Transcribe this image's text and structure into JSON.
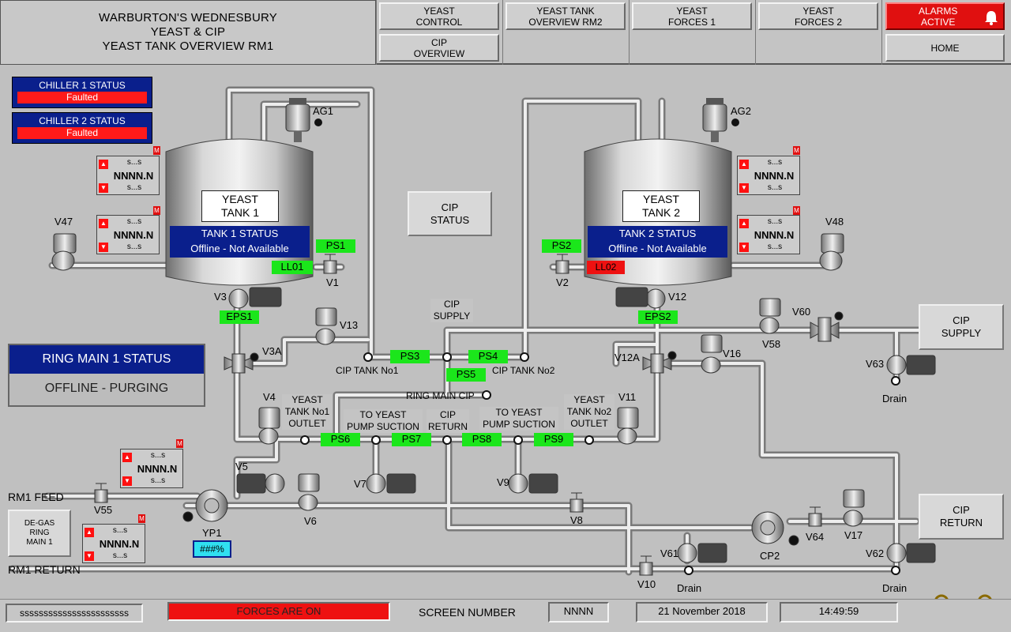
{
  "header": {
    "title_lines": [
      "WARBURTON'S WEDNESBURY",
      "YEAST & CIP",
      "YEAST TANK OVERVIEW RM1"
    ],
    "nav": {
      "yeast_control": "YEAST\nCONTROL",
      "yeast_tank_overview_rm2": "YEAST TANK\nOVERVIEW RM2",
      "yeast_forces_1": "YEAST\nFORCES 1",
      "yeast_forces_2": "YEAST\nFORCES 2",
      "alarms": "ALARMS\nACTIVE",
      "cip_overview": "CIP\nOVERVIEW",
      "home": "HOME"
    }
  },
  "chillers": [
    {
      "label": "CHILLER 1 STATUS",
      "state": "Faulted"
    },
    {
      "label": "CHILLER 2 STATUS",
      "state": "Faulted"
    }
  ],
  "ring_main": {
    "title": "RING MAIN 1 STATUS",
    "state": "OFFLINE - PURGING"
  },
  "tanks": [
    {
      "name_lines": [
        "YEAST",
        "TANK 1"
      ],
      "status_title": "TANK 1 STATUS",
      "status": "Offline - Not Available",
      "agitator": "AG1",
      "level_tag": "LL01",
      "level_color": "#1be61b"
    },
    {
      "name_lines": [
        "YEAST",
        "TANK 2"
      ],
      "status_title": "TANK 2 STATUS",
      "status": "Offline - Not Available",
      "agitator": "AG2",
      "level_tag": "LL02",
      "level_color": "#ee1111"
    }
  ],
  "cip_status": "CIP\nSTATUS",
  "cip_supply_btn": "CIP\nSUPPLY",
  "cip_return_btn": "CIP\nRETURN",
  "degas_btn": "DE-GAS\nRING\nMAIN 1",
  "indicator": {
    "top": "s...s",
    "value": "NNNN.N",
    "bottom": "s...s",
    "badge": "M"
  },
  "pressure_switches": [
    "PS1",
    "PS2",
    "PS3",
    "PS4",
    "PS5",
    "PS6",
    "PS7",
    "PS8",
    "PS9"
  ],
  "eps": [
    "EPS1",
    "EPS2"
  ],
  "valves": [
    "V1",
    "V2",
    "V3",
    "V3A",
    "V4",
    "V5",
    "V6",
    "V7",
    "V8",
    "V9",
    "V10",
    "V11",
    "V12",
    "V12A",
    "V13",
    "V16",
    "V17",
    "V47",
    "V48",
    "V55",
    "V58",
    "V60",
    "V61",
    "V62",
    "V63",
    "V64"
  ],
  "labels": {
    "cip_supply": "CIP\nSUPPLY",
    "cip_tank_no1": "CIP TANK No1",
    "cip_tank_no2": "CIP TANK No2",
    "ring_main_cip": "RING MAIN CIP",
    "yeast_tank_no1_outlet": "YEAST\nTANK No1\nOUTLET",
    "to_yeast_pump_suction_1": "TO YEAST\nPUMP SUCTION",
    "cip_return": "CIP\nRETURN",
    "to_yeast_pump_suction_2": "TO YEAST\nPUMP SUCTION",
    "yeast_tank_no2_outlet": "YEAST\nTANK No2\nOUTLET",
    "rm1_feed": "RM1 FEED",
    "rm1_return": "RM1 RETURN",
    "yp1": "YP1",
    "cp2": "CP2",
    "drain": "Drain"
  },
  "yp1_speed": "###%",
  "footer": {
    "user": "sssssssssssssssssssssss",
    "forces": "FORCES ARE ON",
    "screen_number_label": "SCREEN NUMBER",
    "screen_number": "NNNN",
    "date": "21 November 2018",
    "time": "14:49:59"
  },
  "colors": {
    "panel_blue": "#0a1f8c",
    "alarm_red": "#ee1111",
    "tag_green": "#1be61b",
    "background": "#c0c0c0"
  }
}
